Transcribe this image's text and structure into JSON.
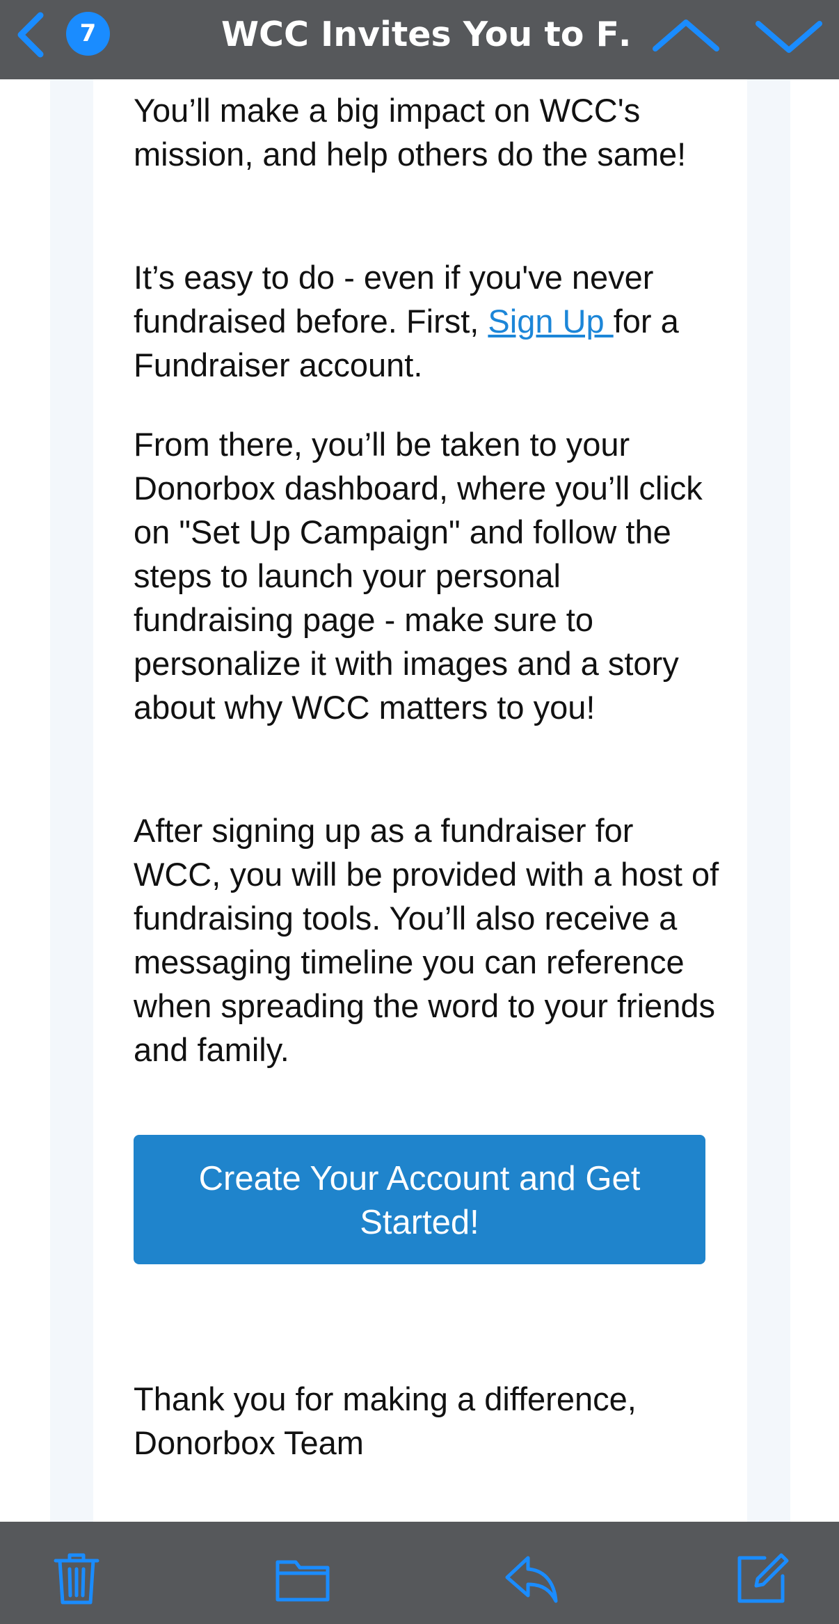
{
  "nav": {
    "unread_count": "7",
    "title": "WCC Invites You to F…",
    "icons": [
      "back-chevron-icon",
      "previous-message-icon",
      "next-message-icon"
    ]
  },
  "email": {
    "p1": "You’ll make a big impact on WCC's mission, and help others do the same!",
    "p2_before": "It’s easy to do - even if you've never fundraised before. First, ",
    "p2_link": "Sign Up ",
    "p2_after": "for a Fundraiser account.",
    "p3": "From there, you’ll be taken to your Donorbox dashboard, where you’ll click on \"Set Up Campaign\" and follow the steps to launch your personal fundraising page - make sure to personalize it with images and a story about why WCC matters to you!",
    "p4": "After signing up as a fundraiser for WCC, you will be provided with a host of fundraising tools. You’ll also receive a messaging timeline you can reference when spreading the word to your friends and family.",
    "cta_label": "Create Your Account and Get Started!",
    "signoff_line1": "Thank you for making a difference,",
    "signoff_line2": "Donorbox Team"
  },
  "toolbar": {
    "icons": [
      "trash-icon",
      "folder-icon",
      "reply-icon",
      "compose-icon"
    ]
  },
  "colors": {
    "accent": "#1a8cff",
    "bar_background": "#56585b",
    "link": "#1c86d8",
    "cta_background": "#1f84cc",
    "gutter": "#f3f7fb"
  }
}
